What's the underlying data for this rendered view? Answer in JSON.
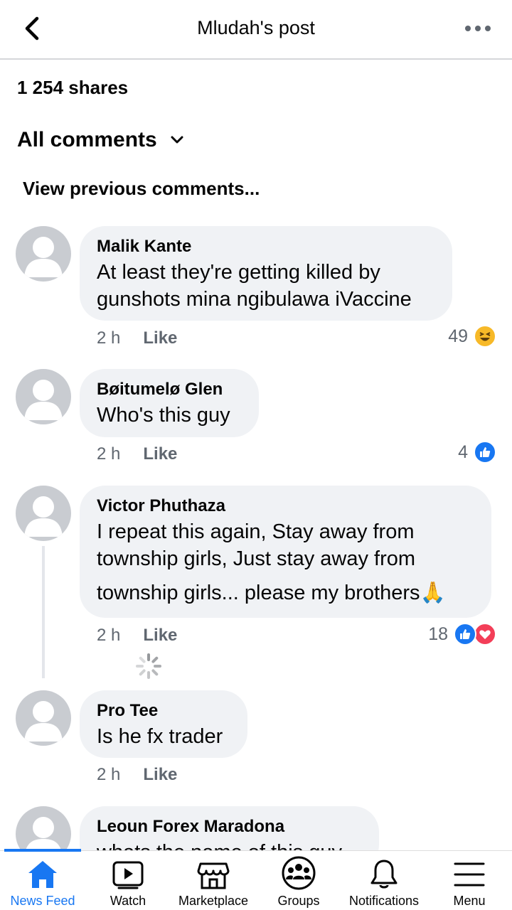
{
  "header": {
    "title": "Mludah's post"
  },
  "post": {
    "shares": "1 254 shares"
  },
  "comments_filter": {
    "label": "All comments"
  },
  "view_previous": "View previous comments...",
  "comments": [
    {
      "name": "Malik Kante",
      "text_lines": [
        "At least they're getting killed by",
        "gunshots mina ngibulawa iVaccine"
      ],
      "time": "2 h",
      "like": "Like",
      "reaction_count": "49",
      "reactions": [
        "haha"
      ]
    },
    {
      "name": "Bøitumelø Glen",
      "text_lines": [
        "Who's this guy"
      ],
      "time": "2 h",
      "like": "Like",
      "reaction_count": "4",
      "reactions": [
        "like"
      ]
    },
    {
      "name": "Victor Phuthaza",
      "text_lines": [
        "I repeat this again, Stay away from",
        "township girls, Just stay away from",
        "township girls... please my brothers🙏"
      ],
      "time": "2 h",
      "like": "Like",
      "reaction_count": "18",
      "reactions": [
        "like",
        "love"
      ]
    },
    {
      "name": "Pro Tee",
      "text_lines": [
        "Is he fx trader"
      ],
      "time": "2 h",
      "like": "Like"
    },
    {
      "name": "Leoun Forex Maradona",
      "text_lines": [
        "whats the name of this guy"
      ]
    }
  ],
  "tabbar": [
    {
      "label": "News Feed",
      "icon": "home-icon",
      "active": true
    },
    {
      "label": "Watch",
      "icon": "watch-icon"
    },
    {
      "label": "Marketplace",
      "icon": "marketplace-icon"
    },
    {
      "label": "Groups",
      "icon": "groups-icon"
    },
    {
      "label": "Notifications",
      "icon": "bell-icon"
    },
    {
      "label": "Menu",
      "icon": "menu-icon"
    }
  ],
  "colors": {
    "accent": "#1877f2",
    "bubble": "#f0f2f5",
    "love": "#f33e58",
    "haha": "#f7b928"
  }
}
